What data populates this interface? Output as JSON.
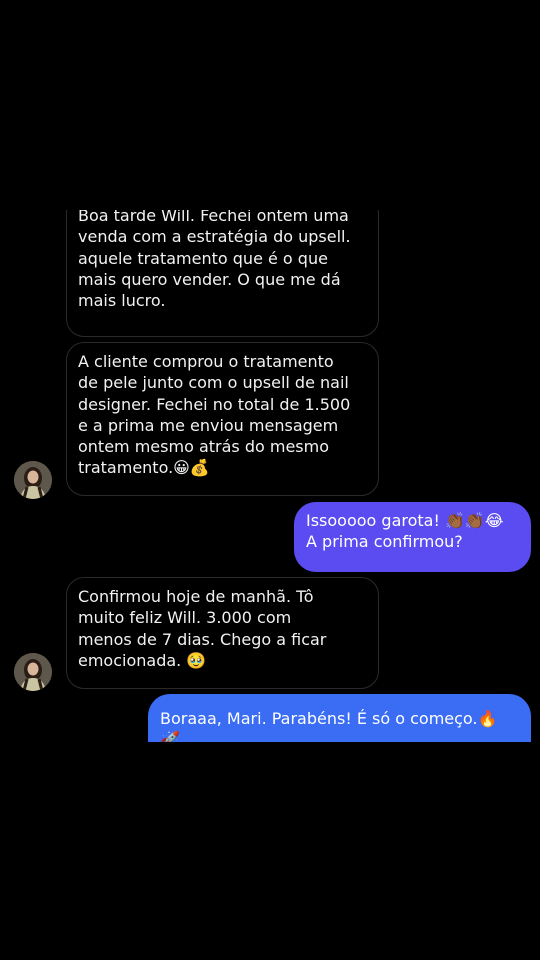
{
  "conversation": {
    "messages": [
      {
        "direction": "incoming",
        "text": "Boa tarde Will. Fechei ontem uma\nvenda com a estratégia do upsell.\naquele tratamento que é o que\nmais quero vender. O que me dá\nmais lucro."
      },
      {
        "direction": "incoming",
        "text": "A cliente comprou o tratamento\nde pele junto com o upsell de nail\ndesigner. Fechei no total de 1.500\ne  a prima me enviou mensagem\nontem mesmo atrás do mesmo\ntratamento.😀💰"
      },
      {
        "direction": "outgoing",
        "text": "Issooooo garota! 👏🏾👏🏾😂\nA prima confirmou?"
      },
      {
        "direction": "incoming",
        "text": "Confirmou hoje de manhã. Tô\nmuito feliz Will. 3.000 com\nmenos de 7 dias. Chego a ficar\nemocionada. 🥹"
      },
      {
        "direction": "outgoing",
        "text": "Boraaa, Mari. Parabéns! É só o começo.🔥\n🚀"
      }
    ]
  },
  "colors": {
    "background": "#000000",
    "incoming_bubble_border": "#2a2a2a",
    "outgoing_bubble_purple": "#5a4cf0",
    "outgoing_bubble_blue": "#3a6cf4"
  },
  "icons": {
    "contact_avatar": "contact-avatar-photo"
  }
}
